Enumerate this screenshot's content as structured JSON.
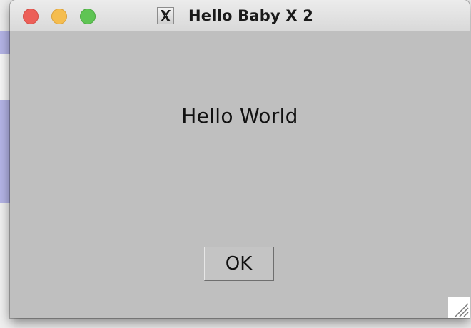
{
  "window": {
    "title": "Hello Baby X 2",
    "title_icon": "x11-icon",
    "controls": [
      "close-button",
      "minimize-button",
      "zoom-button"
    ]
  },
  "content": {
    "message": "Hello World",
    "ok_label": "OK"
  },
  "colors": {
    "client_background": "#bfbfbf",
    "close": "#ec5f58",
    "minimize": "#f5bd4f",
    "zoom": "#5fc454"
  }
}
